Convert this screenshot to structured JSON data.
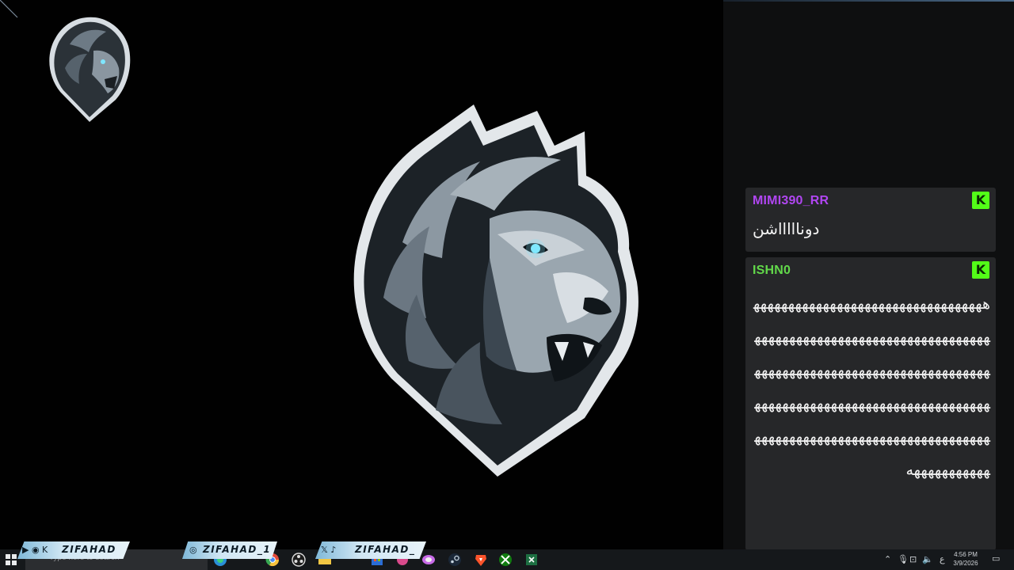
{
  "chat": {
    "messages": [
      {
        "username": "MIMI390_RR",
        "username_color": "#b146f2",
        "badge": "K",
        "text": "دوناااااشن"
      },
      {
        "username": "ISHN0",
        "username_color": "#62d84a",
        "badge": "K",
        "text": "هههههههههههههههههههههههههههههههههههههههههههههههههههههههههههههههههههههههههههههههههههههههههههههههههههههههههههههههههههههههههههههههههههههههههههههههههههههههههههههههههههههههههههههههههههههه"
      }
    ],
    "badge_color": "#53fc18"
  },
  "social": {
    "banner_1": {
      "icons": "▶ ◉ K",
      "label": "ZIFAHAD"
    },
    "banner_2": {
      "icons": "◎",
      "label": "ZIFAHAD_1"
    },
    "banner_3": {
      "icons": "𝕏 ♪",
      "label": "ZIFAHAD_"
    }
  },
  "taskbar": {
    "search_placeholder": "Type here to search",
    "tray_lang": "ع",
    "time": "4:56 PM",
    "date": "3/9/2026",
    "pinned_icons": [
      "edge-icon",
      "chrome-icon",
      "obs-icon",
      "file-explorer-icon",
      "store-icon",
      "brave-icon",
      "steam-icon",
      "xbox-icon",
      "excel-icon"
    ]
  },
  "colors": {
    "desktop_bg": "#010101",
    "chat_panel_bg": "#0e0f10",
    "chat_card_bg": "#262729",
    "taskbar_bg": "#15181b"
  }
}
